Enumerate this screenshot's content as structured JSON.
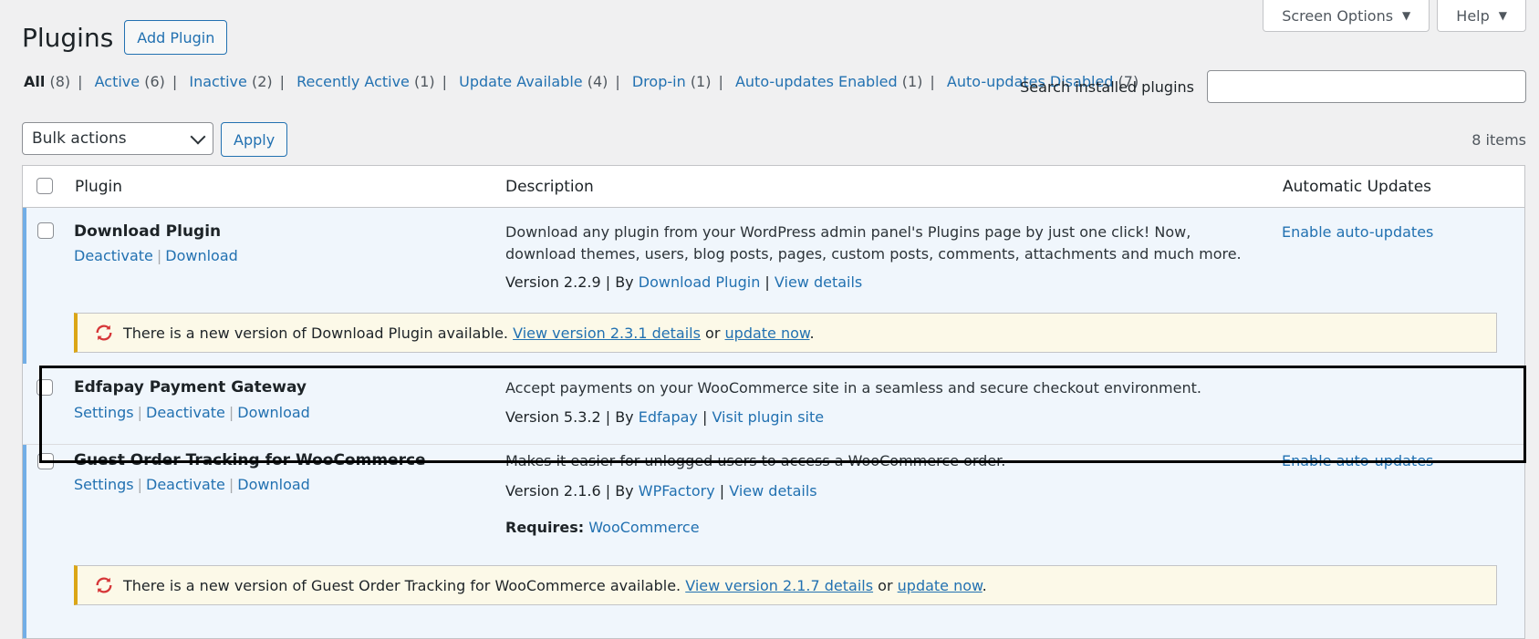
{
  "header": {
    "screen_options": "Screen Options",
    "help": "Help",
    "title": "Plugins",
    "add_plugin": "Add Plugin"
  },
  "filters": [
    {
      "label": "All",
      "count": "(8)",
      "current": true
    },
    {
      "label": "Active",
      "count": "(6)"
    },
    {
      "label": "Inactive",
      "count": "(2)"
    },
    {
      "label": "Recently Active",
      "count": "(1)"
    },
    {
      "label": "Update Available",
      "count": "(4)"
    },
    {
      "label": "Drop-in",
      "count": "(1)"
    },
    {
      "label": "Auto-updates Enabled",
      "count": "(1)"
    },
    {
      "label": "Auto-updates Disabled",
      "count": "(7)"
    }
  ],
  "search": {
    "label": "Search installed plugins",
    "value": ""
  },
  "bulk": {
    "selected": "Bulk actions",
    "apply": "Apply",
    "items_count": "8 items"
  },
  "columns": {
    "plugin": "Plugin",
    "description": "Description",
    "auto_updates": "Automatic Updates"
  },
  "rows": [
    {
      "name": "Download Plugin",
      "actions": [
        "Deactivate",
        "Download"
      ],
      "description": "Download any plugin from your WordPress admin panel's Plugins page by just one click! Now, download themes, users, blog posts, pages, custom posts, comments, attachments and much more.",
      "version": "Version 2.2.9",
      "by": "By",
      "author": "Download Plugin",
      "details": "View details",
      "auto": "Enable auto-updates",
      "notice": {
        "prefix": "There is a new version of Download Plugin available.",
        "view": "View version 2.3.1 details",
        "or": "or",
        "update": "update now",
        "end": "."
      }
    },
    {
      "name": "Edfapay Payment Gateway",
      "actions": [
        "Settings",
        "Deactivate",
        "Download"
      ],
      "description": "Accept payments on your WooCommerce site in a seamless and secure checkout environment.",
      "version": "Version 5.3.2",
      "by": "By",
      "author": "Edfapay",
      "details": "Visit plugin site"
    },
    {
      "name": "Guest Order Tracking for WooCommerce",
      "actions": [
        "Settings",
        "Deactivate",
        "Download"
      ],
      "description": "Makes it easier for unlogged users to access a WooCommerce order.",
      "version": "Version 2.1.6",
      "by": "By",
      "author": "WPFactory",
      "details": "View details",
      "requires_label": "Requires:",
      "requires": "WooCommerce",
      "auto": "Enable auto-updates",
      "notice": {
        "prefix": "There is a new version of Guest Order Tracking for WooCommerce available.",
        "view": "View version 2.1.7 details",
        "or": "or",
        "update": "update now",
        "end": "."
      }
    }
  ],
  "colors": {
    "link": "#2271b1",
    "active_border": "#72aee6",
    "notice_border": "#dba617",
    "update_icon": "#d63638"
  }
}
